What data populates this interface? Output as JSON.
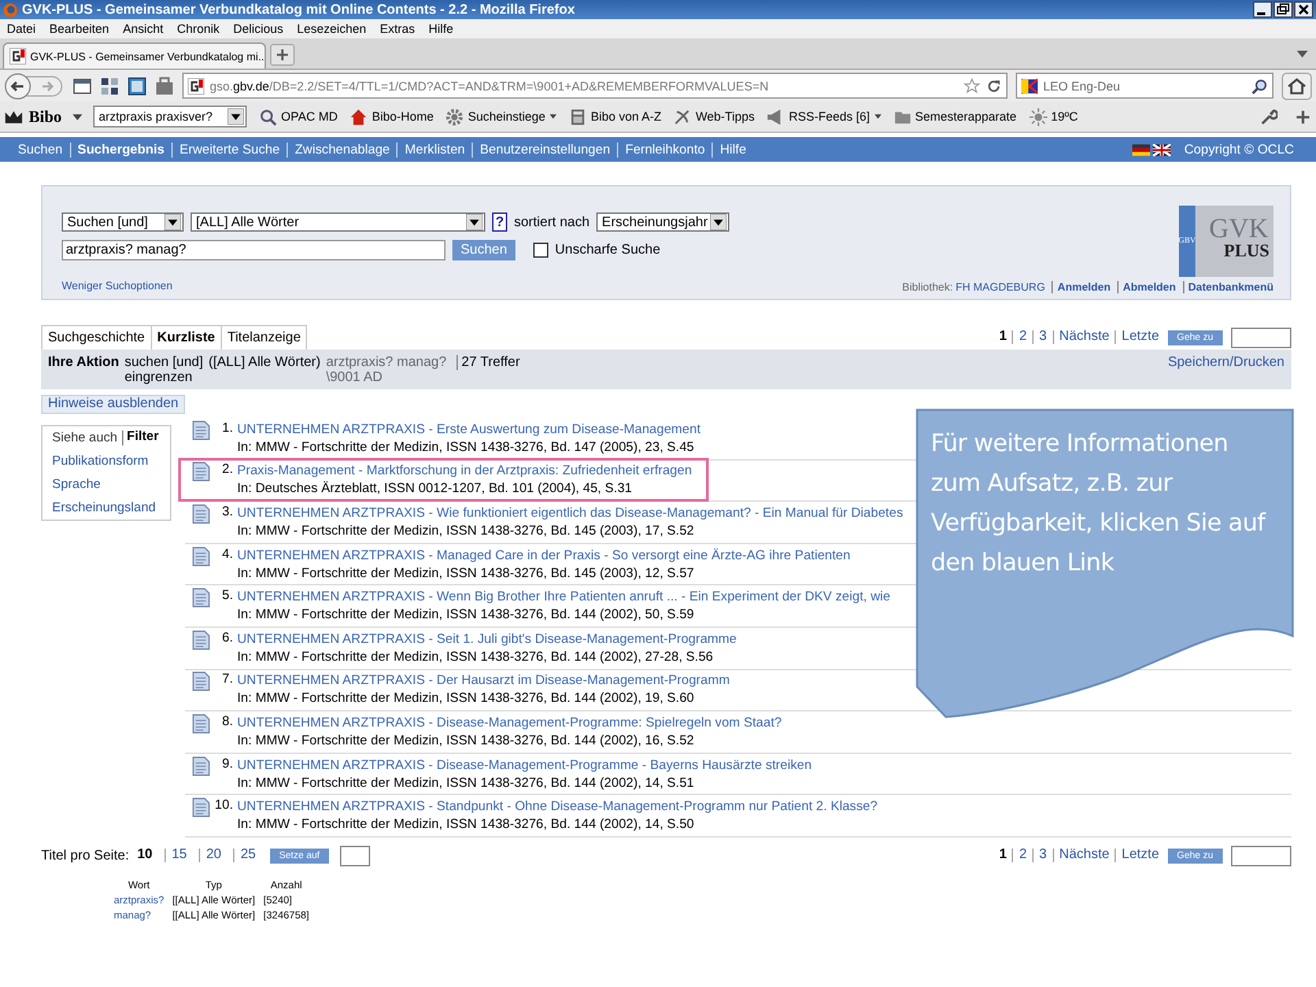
{
  "window": {
    "title": "GVK-PLUS - Gemeinsamer Verbundkatalog mit Online Contents - 2.2 - Mozilla Firefox"
  },
  "menu": [
    "Datei",
    "Bearbeiten",
    "Ansicht",
    "Chronik",
    "Delicious",
    "Lesezeichen",
    "Extras",
    "Hilfe"
  ],
  "browser_tab": {
    "title": "GVK-PLUS - Gemeinsamer Verbundkatalog mi..."
  },
  "address_bar": {
    "host_prefix": "gso.",
    "host": "gbv.de",
    "path": "/DB=2.2/SET=4/TTL=1/CMD?ACT=AND&TRM=\\9001+AD&REMEMBERFORMVALUES=N"
  },
  "search_bar": {
    "value": "LEO Eng-Deu"
  },
  "toolbar": {
    "brand": "Bibo",
    "search_value": "arztpraxis praxisver?",
    "items": [
      {
        "label": "OPAC MD",
        "dropdown": false
      },
      {
        "label": "Bibo-Home",
        "dropdown": false
      },
      {
        "label": "Sucheinstiege",
        "dropdown": true
      },
      {
        "label": "Bibo von A-Z",
        "dropdown": false
      },
      {
        "label": "Web-Tipps",
        "dropdown": false
      },
      {
        "label": "RSS-Feeds [6]",
        "dropdown": true
      },
      {
        "label": "Semesterapparate",
        "dropdown": false
      },
      {
        "label": "19ºC",
        "dropdown": false
      }
    ]
  },
  "site_nav": {
    "items": [
      {
        "label": "Suchen",
        "selected": false
      },
      {
        "label": "Suchergebnis",
        "selected": true
      },
      {
        "label": "Erweiterte Suche",
        "selected": false
      },
      {
        "label": "Zwischenablage",
        "selected": false
      },
      {
        "label": "Merklisten",
        "selected": false
      },
      {
        "label": "Benutzereinstellungen",
        "selected": false
      },
      {
        "label": "Fernleihkonto",
        "selected": false
      },
      {
        "label": "Hilfe",
        "selected": false
      }
    ],
    "copyright": "Copyright © OCLC"
  },
  "search_form": {
    "mode_select": "Suchen [und]",
    "index_select": "[ALL] Alle Wörter",
    "help": "?",
    "sort_label": "sortiert nach",
    "sort_select": "Erscheinungsjahr",
    "query": "arztpraxis? manag?",
    "search_button": "Suchen",
    "fuzzy": {
      "label": "Unscharfe Suche",
      "checked": false
    },
    "less_options": "Weniger Suchoptionen",
    "library_label": "Bibliothek:",
    "library": "FH MAGDEBURG",
    "links": [
      "Anmelden",
      "Abmelden",
      "Datenbankmenü"
    ],
    "logo": {
      "side": "GBV",
      "top": "GVK",
      "bottom": "PLUS"
    }
  },
  "view_tabs": [
    {
      "label": "Suchgeschichte",
      "selected": false
    },
    {
      "label": "Kurzliste",
      "selected": true
    },
    {
      "label": "Titelanzeige",
      "selected": false
    }
  ],
  "pagination_top": {
    "pages": [
      {
        "label": "1",
        "selected": true
      },
      {
        "label": "2",
        "selected": false
      },
      {
        "label": "3",
        "selected": false
      }
    ],
    "next": "Nächste",
    "last": "Letzte",
    "goto_button": "Gehe zu"
  },
  "action": {
    "label": "Ihre Aktion",
    "verb": "suchen [und]",
    "verb2": "eingrenzen",
    "index": "([ALL] Alle Wörter)",
    "terms": "arztpraxis? manag?",
    "terms2": "\\9001 AD",
    "hits": "27 Treffer",
    "save_link": "Speichern/Drucken"
  },
  "hints_toggle": "Hinweise ausblenden",
  "sidebar": {
    "tabs": [
      {
        "label": "Siehe auch",
        "selected": false
      },
      {
        "label": "Filter",
        "selected": true
      }
    ],
    "items": [
      "Publikationsform",
      "Sprache",
      "Erscheinungsland"
    ]
  },
  "results": [
    {
      "number": "1.",
      "title": "UNTERNEHMEN ARZTPRAXIS - Erste Auswertung zum Disease-Management",
      "source": "In: MMW - Fortschritte der Medizin, ISSN 1438-3276, Bd. 147 (2005), 23, S.45",
      "highlighted": false
    },
    {
      "number": "2.",
      "title": "Praxis-Management - Marktforschung in der Arztpraxis: Zufriedenheit erfragen",
      "source": "In: Deutsches Ärzteblatt, ISSN 0012-1207, Bd. 101 (2004), 45, S.31",
      "highlighted": true
    },
    {
      "number": "3.",
      "title": "UNTERNEHMEN ARZTPRAXIS - Wie funktioniert eigentlich das Disease-Managemant? - Ein Manual für Diabetes",
      "source": "In: MMW - Fortschritte der Medizin, ISSN 1438-3276, Bd. 145 (2003), 17, S.52",
      "highlighted": false
    },
    {
      "number": "4.",
      "title": "UNTERNEHMEN ARZTPRAXIS - Managed Care in der Praxis - So versorgt eine Ärzte-AG ihre Patienten",
      "source": "In: MMW - Fortschritte der Medizin, ISSN 1438-3276, Bd. 145 (2003), 12, S.57",
      "highlighted": false
    },
    {
      "number": "5.",
      "title": "UNTERNEHMEN ARZTPRAXIS - Wenn Big Brother Ihre Patienten anruft ... - Ein Experiment der DKV zeigt, wie",
      "source": "In: MMW - Fortschritte der Medizin, ISSN 1438-3276, Bd. 144 (2002), 50, S.59",
      "highlighted": false
    },
    {
      "number": "6.",
      "title": "UNTERNEHMEN ARZTPRAXIS - Seit 1. Juli gibt's Disease-Management-Programme",
      "source": "In: MMW - Fortschritte der Medizin, ISSN 1438-3276, Bd. 144 (2002), 27-28, S.56",
      "highlighted": false
    },
    {
      "number": "7.",
      "title": "UNTERNEHMEN ARZTPRAXIS - Der Hausarzt im Disease-Management-Programm",
      "source": "In: MMW - Fortschritte der Medizin, ISSN 1438-3276, Bd. 144 (2002), 19, S.60",
      "highlighted": false
    },
    {
      "number": "8.",
      "title": "UNTERNEHMEN ARZTPRAXIS - Disease-Management-Programme: Spielregeln vom Staat?",
      "source": "In: MMW - Fortschritte der Medizin, ISSN 1438-3276, Bd. 144 (2002), 16, S.52",
      "highlighted": false
    },
    {
      "number": "9.",
      "title": "UNTERNEHMEN ARZTPRAXIS - Disease-Management-Programme - Bayerns Hausärzte streiken",
      "source": "In: MMW - Fortschritte der Medizin, ISSN 1438-3276, Bd. 144 (2002), 14, S.51",
      "highlighted": false
    },
    {
      "number": "10.",
      "title": "UNTERNEHMEN ARZTPRAXIS - Standpunkt - Ohne Disease-Management-Programm nur Patient 2. Klasse?",
      "source": "In: MMW - Fortschritte der Medizin, ISSN 1438-3276, Bd. 144 (2002), 14, S.50",
      "highlighted": false
    }
  ],
  "per_page": {
    "label": "Titel pro Seite:",
    "options": [
      {
        "label": "10",
        "selected": true
      },
      {
        "label": "15",
        "selected": false
      },
      {
        "label": "20",
        "selected": false
      },
      {
        "label": "25",
        "selected": false
      }
    ],
    "button": "Setze auf"
  },
  "pagination_bottom": {
    "pages": [
      {
        "label": "1",
        "selected": true
      },
      {
        "label": "2",
        "selected": false
      },
      {
        "label": "3",
        "selected": false
      }
    ],
    "next": "Nächste",
    "last": "Letzte",
    "goto_button": "Gehe zu"
  },
  "term_table": {
    "columns": [
      "Wort",
      "Typ",
      "Anzahl"
    ],
    "rows": [
      {
        "word": "arztpraxis?",
        "type": "[[ALL] Alle Wörter]",
        "count": "[5240]"
      },
      {
        "word": "manag?",
        "type": "[[ALL] Alle Wörter]",
        "count": "[3246758]"
      }
    ]
  },
  "callout": {
    "text": "Für weitere Informationen zum Aufsatz, z.B. zur Verfügbarkeit, klicken Sie auf den blauen Link"
  }
}
